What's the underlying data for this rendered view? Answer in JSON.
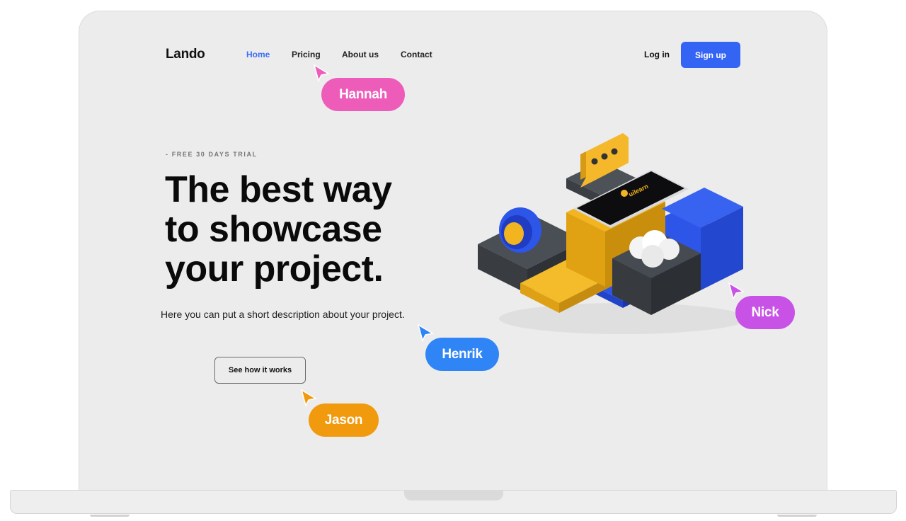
{
  "nav": {
    "logo": "Lando",
    "links": [
      "Home",
      "Pricing",
      "About us",
      "Contact"
    ],
    "active": "Home",
    "login_label": "Log in",
    "signup_label": "Sign up"
  },
  "hero": {
    "eyebrow": "- FREE 30 DAYS TRIAL",
    "headline": [
      "The best way",
      "to showcase",
      "your project."
    ],
    "description": "Here you can put a short description about your project.",
    "cta_label": "See how it works"
  },
  "illustration": {
    "phone_brand": "uilearn"
  },
  "cursors": [
    {
      "name": "Hannah",
      "color": "#ee5cba"
    },
    {
      "name": "Henrik",
      "color": "#2f85f6"
    },
    {
      "name": "Jason",
      "color": "#f29a0d"
    },
    {
      "name": "Nick",
      "color": "#c852e6"
    }
  ],
  "colors": {
    "accent": "#3464f4",
    "screen_background": "#ececec",
    "block_yellow": "#f2b51f",
    "block_blue": "#2d55e8",
    "block_dark": "#3d4247"
  }
}
